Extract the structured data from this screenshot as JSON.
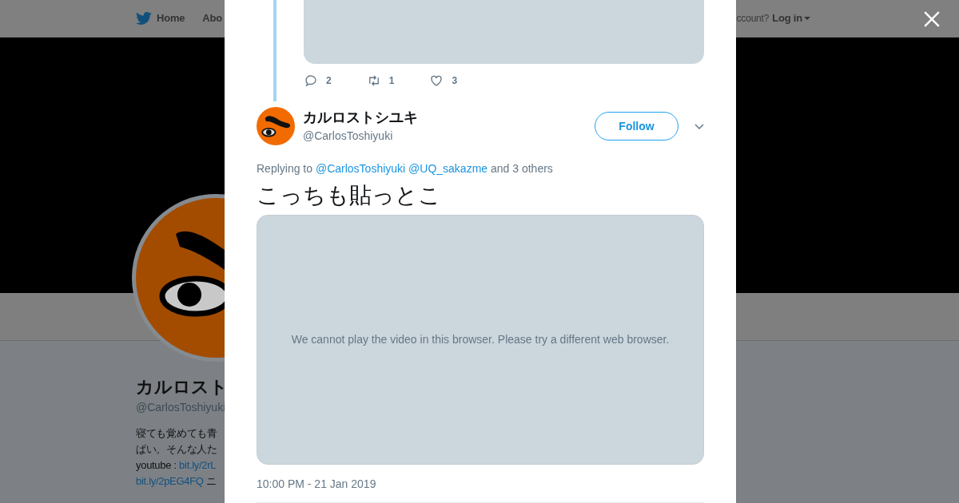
{
  "nav": {
    "items": [
      {
        "kind": "home",
        "label": "Home"
      },
      {
        "kind": "plain",
        "label": "Abo"
      }
    ],
    "account_prompt": "ccount?",
    "login": "Log in"
  },
  "profile": {
    "name": "カルロスト",
    "handle": "@CarlosToshiyuki",
    "bio": [
      "寝ても覚めても青",
      "ぱい。そんな人た",
      {
        "prefix": "youtube : ",
        "link": "bit.ly/2rL"
      },
      {
        "link": "bit.ly/2pEG4FQ",
        "suffix": " ニ"
      }
    ]
  },
  "modal": {
    "previous_tweet": {
      "actions": [
        {
          "kind": "reply",
          "count": "2"
        },
        {
          "kind": "retweet",
          "count": "1"
        },
        {
          "kind": "like",
          "count": "3"
        }
      ]
    },
    "tweet": {
      "name": "カルロストシユキ",
      "handle": "@CarlosToshiyuki",
      "follow": "Follow",
      "replying_prefix": "Replying to",
      "mentions": [
        "@CarlosToshiyuki",
        "@UQ_sakazme"
      ],
      "replying_suffix": "and 3 others",
      "text": "こっちも貼っとこ",
      "video_message": "We cannot play the video in this browser. Please try a different web browser.",
      "timestamp": "10:00 PM - 21 Jan 2019"
    }
  }
}
